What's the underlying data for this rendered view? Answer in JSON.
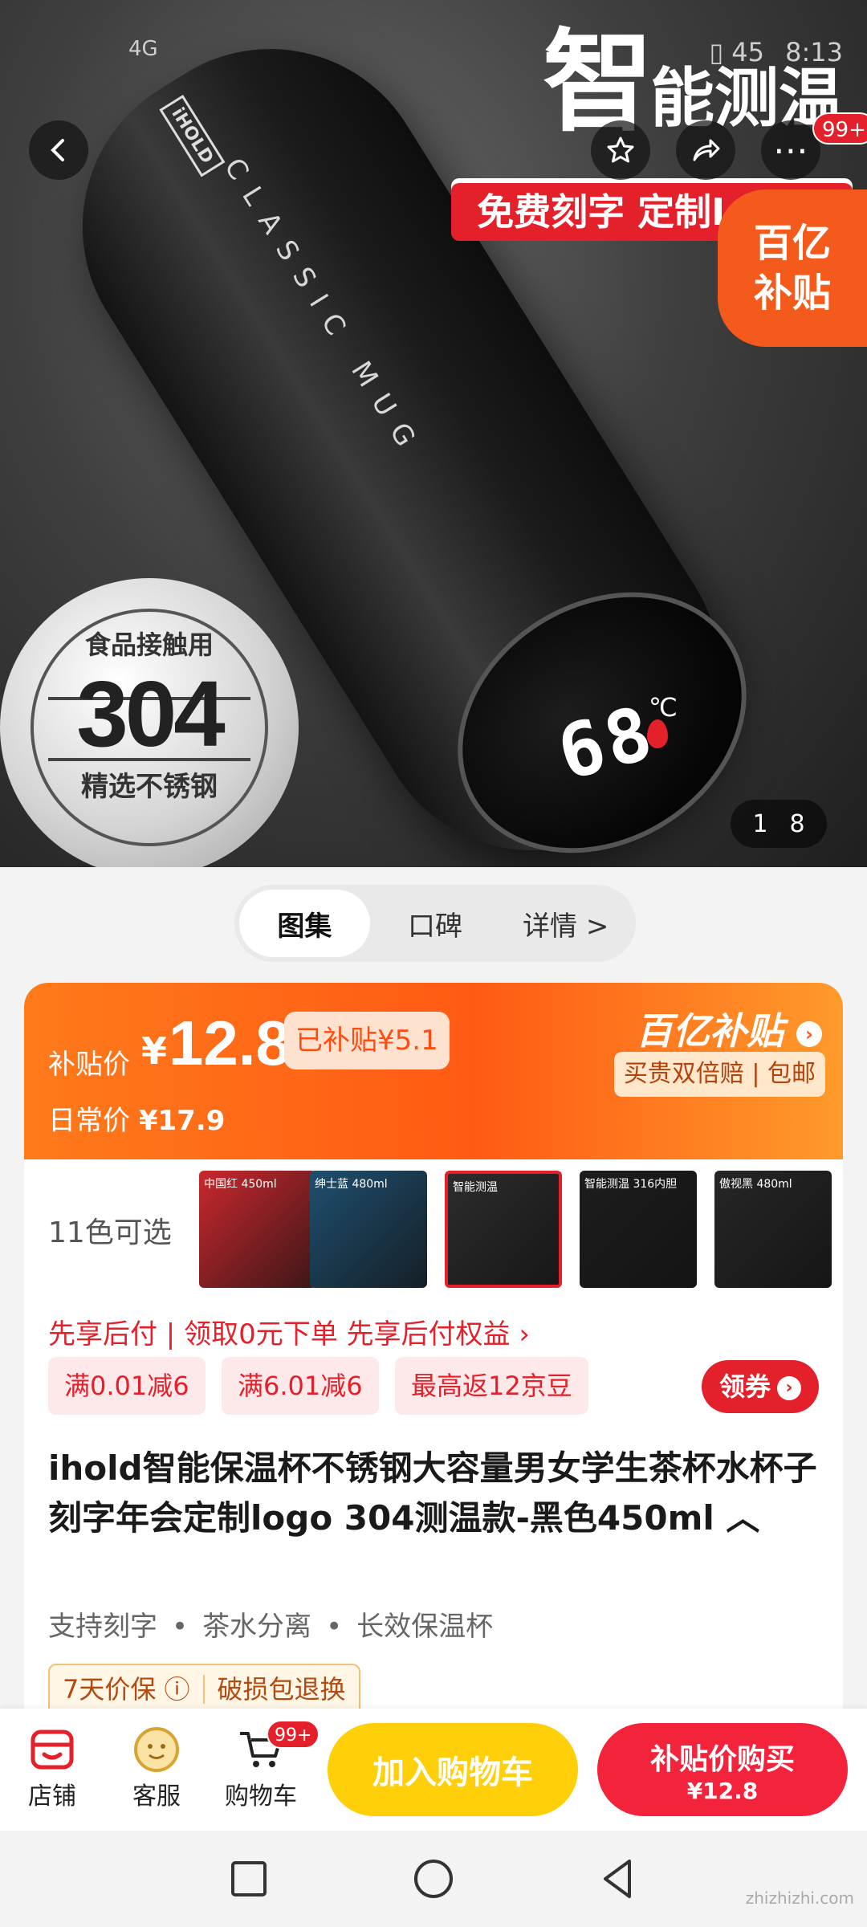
{
  "status_bar": {
    "signal": "4G",
    "battery": "45",
    "time": "8:13"
  },
  "hero": {
    "title_big": "智",
    "title_rest": "能测温",
    "banner": "免费刻字 定制LOGO",
    "subsidy_corner_line1": "百亿",
    "subsidy_corner_line2": "补贴",
    "bottle_brand": "iHOLD",
    "bottle_text": "CLASSIC MUG",
    "temperature": "68",
    "temperature_unit": "℃",
    "badge_top": "食品接触用",
    "badge_number": "304",
    "badge_bottom": "精选不锈钢",
    "more_badge": "99+",
    "pager_current": "1",
    "pager_total": "8"
  },
  "tabs": [
    {
      "label": "图集"
    },
    {
      "label": "口碑"
    },
    {
      "label": "详情 >"
    }
  ],
  "price": {
    "label": "补贴价",
    "currency": "¥",
    "value": "12.8",
    "subsidized": "已补贴¥5.1",
    "daily_label": "日常价",
    "daily_value": "¥17.9",
    "brand": "百亿补贴",
    "guarantee": "买贵双倍赔 | 包邮"
  },
  "colors": {
    "count_label": "11色可选",
    "thumbnails": [
      {
        "caption": "中国红 450ml",
        "color": "#c9282d"
      },
      {
        "caption": "绅士蓝 480ml",
        "color": "#1f4f6f"
      },
      {
        "caption": "智能测温",
        "color": "#2c2c2c"
      },
      {
        "caption": "智能测温 316内胆",
        "color": "#1d1d1d"
      },
      {
        "caption": "傲视黑 480ml",
        "color": "#262626"
      }
    ]
  },
  "promo_line": "先享后付 | 领取0元下单 先享后付权益 ›",
  "coupons": [
    "满0.01减6",
    "满6.01减6",
    "最高返12京豆"
  ],
  "get_coupon": "领券",
  "product_title": "ihold智能保温杯不锈钢大容量男女学生茶杯水杯子刻字年会定制logo 304测温款-黑色450ml ︿",
  "features": [
    "支持刻字",
    "茶水分离",
    "长效保温杯"
  ],
  "tags": [
    "7天价保 ⓘ",
    "破损包退换"
  ],
  "action_bar": {
    "store": "店铺",
    "service": "客服",
    "cart": "购物车",
    "cart_badge": "99+",
    "add_to_cart": "加入购物车",
    "buy_line1": "补贴价购买",
    "buy_line2": "¥12.8"
  },
  "watermark": "zhizhizhi.com",
  "colors_theme": {
    "accent_red": "#e4202a",
    "accent_orange": "#ff5a14",
    "cart_yellow": "#ffd00a"
  }
}
